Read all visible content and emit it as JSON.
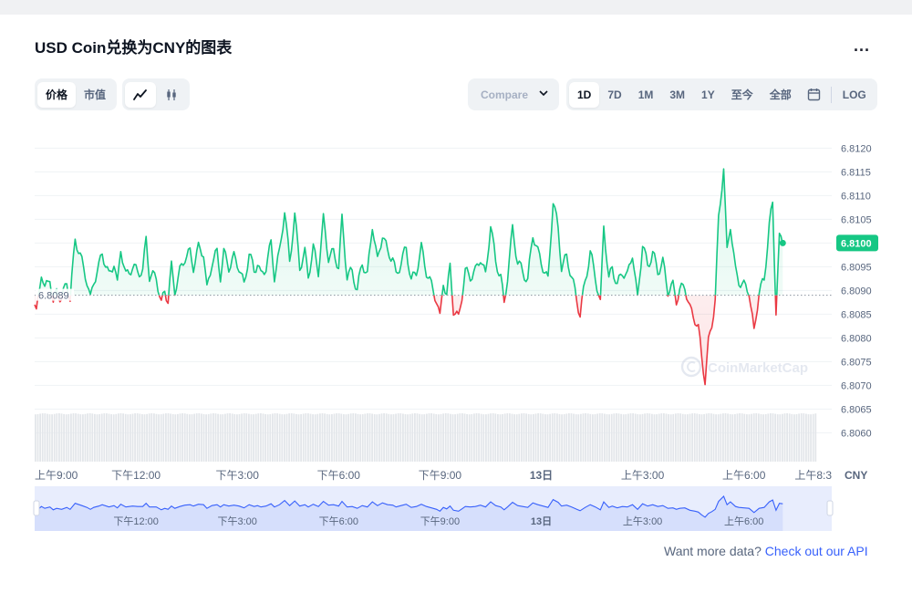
{
  "title": "USD Coin兑换为CNY的图表",
  "more_label": "...",
  "data_type_tabs": [
    {
      "label": "价格",
      "active": true
    },
    {
      "label": "市值",
      "active": false
    }
  ],
  "chart_style_icons": [
    "line-chart-icon",
    "candlestick-icon"
  ],
  "compare_label": "Compare ",
  "range_tabs": [
    {
      "label": "1D",
      "active": true
    },
    {
      "label": "7D",
      "active": false
    },
    {
      "label": "1M",
      "active": false
    },
    {
      "label": "3M",
      "active": false
    },
    {
      "label": "1Y",
      "active": false
    },
    {
      "label": "至今",
      "active": false
    },
    {
      "label": "全部",
      "active": false
    }
  ],
  "log_label": "LOG",
  "watermark": "CoinMarketCap",
  "footer": {
    "text": "Want more data?",
    "link": "Check out our API"
  },
  "colors": {
    "up": "#16c784",
    "down": "#ea3943",
    "navigator": "#3861fb",
    "accent": "#3861fb"
  },
  "chart_data": {
    "type": "line",
    "currency_label": "CNY",
    "baseline": 6.8089,
    "baseline_label": "6.8089",
    "current": 6.81,
    "current_label": "6.8100",
    "ylim": [
      6.8057,
      6.8122
    ],
    "y_ticks": [
      "6.8120",
      "6.8115",
      "6.8110",
      "6.8105",
      "6.8100",
      "6.8095",
      "6.8090",
      "6.8085",
      "6.8080",
      "6.8075",
      "6.8070",
      "6.8065",
      "6.8060"
    ],
    "x_range_hours": [
      0,
      23.6
    ],
    "x_ticks": [
      {
        "label": "上午9:00",
        "hour": 0
      },
      {
        "label": "下午12:00",
        "hour": 3
      },
      {
        "label": "下午3:00",
        "hour": 6
      },
      {
        "label": "下午6:00",
        "hour": 9
      },
      {
        "label": "下午9:00",
        "hour": 12
      },
      {
        "label": "13日",
        "hour": 15
      },
      {
        "label": "上午3:00",
        "hour": 18
      },
      {
        "label": "上午6:00",
        "hour": 21
      },
      {
        "label": "上午8:3",
        "hour": 23.5
      }
    ],
    "navigator_ticks": [
      {
        "label": "下午12:00",
        "hour": 3
      },
      {
        "label": "下午3:00",
        "hour": 6
      },
      {
        "label": "下午6:00",
        "hour": 9
      },
      {
        "label": "下午9:00",
        "hour": 12
      },
      {
        "label": "13日",
        "hour": 15
      },
      {
        "label": "上午3:00",
        "hour": 18
      },
      {
        "label": "上午6:00",
        "hour": 21
      }
    ],
    "anchors": [
      [
        0,
        6.8087
      ],
      [
        0.05,
        6.8085
      ],
      [
        0.2,
        6.8094
      ],
      [
        0.3,
        6.809
      ],
      [
        0.45,
        6.8093
      ],
      [
        0.55,
        6.8087
      ],
      [
        0.65,
        6.809
      ],
      [
        0.8,
        6.8088
      ],
      [
        0.95,
        6.8092
      ],
      [
        1.05,
        6.8088
      ],
      [
        1.2,
        6.8101
      ],
      [
        1.4,
        6.8096
      ],
      [
        1.55,
        6.8092
      ],
      [
        1.65,
        6.8088
      ],
      [
        1.75,
        6.8092
      ],
      [
        1.9,
        6.8095
      ],
      [
        2.0,
        6.8098
      ],
      [
        2.2,
        6.8093
      ],
      [
        2.35,
        6.8096
      ],
      [
        2.45,
        6.8091
      ],
      [
        2.55,
        6.8099
      ],
      [
        2.7,
        6.8093
      ],
      [
        2.9,
        6.8095
      ],
      [
        3.05,
        6.8094
      ],
      [
        3.2,
        6.8094
      ],
      [
        3.3,
        6.8101
      ],
      [
        3.4,
        6.8093
      ],
      [
        3.6,
        6.8093
      ],
      [
        3.75,
        6.8087
      ],
      [
        3.85,
        6.809
      ],
      [
        3.95,
        6.8088
      ],
      [
        4.05,
        6.8095
      ],
      [
        4.15,
        6.809
      ],
      [
        4.3,
        6.8094
      ],
      [
        4.45,
        6.8097
      ],
      [
        4.6,
        6.8098
      ],
      [
        4.7,
        6.8095
      ],
      [
        4.85,
        6.8099
      ],
      [
        5.0,
        6.8098
      ],
      [
        5.1,
        6.809
      ],
      [
        5.25,
        6.8096
      ],
      [
        5.4,
        6.8098
      ],
      [
        5.5,
        6.8093
      ],
      [
        5.6,
        6.8098
      ],
      [
        5.75,
        6.8095
      ],
      [
        5.9,
        6.8097
      ],
      [
        6.05,
        6.8095
      ],
      [
        6.2,
        6.8091
      ],
      [
        6.35,
        6.8098
      ],
      [
        6.5,
        6.8094
      ],
      [
        6.6,
        6.8096
      ],
      [
        6.7,
        6.8093
      ],
      [
        6.85,
        6.8095
      ],
      [
        7.0,
        6.81
      ],
      [
        7.1,
        6.8093
      ],
      [
        7.25,
        6.8098
      ],
      [
        7.4,
        6.8107
      ],
      [
        7.55,
        6.8096
      ],
      [
        7.7,
        6.8106
      ],
      [
        7.85,
        6.8095
      ],
      [
        8.0,
        6.8098
      ],
      [
        8.1,
        6.8093
      ],
      [
        8.25,
        6.8099
      ],
      [
        8.4,
        6.8094
      ],
      [
        8.55,
        6.8105
      ],
      [
        8.7,
        6.8097
      ],
      [
        8.85,
        6.8098
      ],
      [
        9.0,
        6.8095
      ],
      [
        9.1,
        6.8105
      ],
      [
        9.25,
        6.8093
      ],
      [
        9.4,
        6.8094
      ],
      [
        9.55,
        6.809
      ],
      [
        9.7,
        6.8096
      ],
      [
        9.85,
        6.8093
      ],
      [
        10.0,
        6.8104
      ],
      [
        10.15,
        6.8096
      ],
      [
        10.3,
        6.8102
      ],
      [
        10.45,
        6.8098
      ],
      [
        10.6,
        6.8097
      ],
      [
        10.7,
        6.8093
      ],
      [
        10.85,
        6.8096
      ],
      [
        11.0,
        6.8099
      ],
      [
        11.15,
        6.8092
      ],
      [
        11.3,
        6.8094
      ],
      [
        11.45,
        6.8099
      ],
      [
        11.6,
        6.8094
      ],
      [
        11.75,
        6.8091
      ],
      [
        11.9,
        6.8088
      ],
      [
        12.0,
        6.8084
      ],
      [
        12.1,
        6.8092
      ],
      [
        12.2,
        6.8089
      ],
      [
        12.3,
        6.8095
      ],
      [
        12.4,
        6.8086
      ],
      [
        12.55,
        6.8084
      ],
      [
        12.65,
        6.8089
      ],
      [
        12.75,
        6.8094
      ],
      [
        12.9,
        6.8093
      ],
      [
        13.05,
        6.8094
      ],
      [
        13.2,
        6.8097
      ],
      [
        13.35,
        6.8093
      ],
      [
        13.5,
        6.8104
      ],
      [
        13.65,
        6.8096
      ],
      [
        13.8,
        6.8093
      ],
      [
        13.9,
        6.8087
      ],
      [
        14.0,
        6.8093
      ],
      [
        14.15,
        6.8103
      ],
      [
        14.3,
        6.8096
      ],
      [
        14.45,
        6.8094
      ],
      [
        14.6,
        6.8092
      ],
      [
        14.75,
        6.8102
      ],
      [
        14.9,
        6.8098
      ],
      [
        15.05,
        6.8095
      ],
      [
        15.2,
        6.8092
      ],
      [
        15.35,
        6.8109
      ],
      [
        15.5,
        6.8103
      ],
      [
        15.6,
        6.8095
      ],
      [
        15.75,
        6.8097
      ],
      [
        15.9,
        6.8093
      ],
      [
        16.05,
        6.8088
      ],
      [
        16.15,
        6.8085
      ],
      [
        16.3,
        6.8092
      ],
      [
        16.45,
        6.8098
      ],
      [
        16.6,
        6.8093
      ],
      [
        16.75,
        6.8087
      ],
      [
        16.85,
        6.8104
      ],
      [
        17.0,
        6.8092
      ],
      [
        17.1,
        6.8095
      ],
      [
        17.25,
        6.8091
      ],
      [
        17.4,
        6.8094
      ],
      [
        17.55,
        6.8093
      ],
      [
        17.7,
        6.8098
      ],
      [
        17.85,
        6.8088
      ],
      [
        18.0,
        6.81
      ],
      [
        18.15,
        6.8095
      ],
      [
        18.3,
        6.8098
      ],
      [
        18.45,
        6.8094
      ],
      [
        18.6,
        6.8096
      ],
      [
        18.75,
        6.809
      ],
      [
        18.9,
        6.8091
      ],
      [
        19.0,
        6.8088
      ],
      [
        19.1,
        6.809
      ],
      [
        19.25,
        6.8091
      ],
      [
        19.4,
        6.8086
      ],
      [
        19.55,
        6.8084
      ],
      [
        19.65,
        6.8082
      ],
      [
        19.75,
        6.8076
      ],
      [
        19.85,
        6.8071
      ],
      [
        19.95,
        6.8079
      ],
      [
        20.05,
        6.8083
      ],
      [
        20.15,
        6.8088
      ],
      [
        20.25,
        6.8105
      ],
      [
        20.4,
        6.8116
      ],
      [
        20.5,
        6.8098
      ],
      [
        20.6,
        6.8104
      ],
      [
        20.75,
        6.8094
      ],
      [
        20.85,
        6.8092
      ],
      [
        21.0,
        6.8091
      ],
      [
        21.15,
        6.809
      ],
      [
        21.3,
        6.8081
      ],
      [
        21.45,
        6.809
      ],
      [
        21.6,
        6.8092
      ],
      [
        21.75,
        6.8104
      ],
      [
        21.85,
        6.8108
      ],
      [
        21.95,
        6.8086
      ],
      [
        22.05,
        6.8101
      ],
      [
        22.15,
        6.81
      ]
    ],
    "sample_step_hours": 0.05,
    "volume_bars": "uniform light-gray volume bars across full range"
  }
}
